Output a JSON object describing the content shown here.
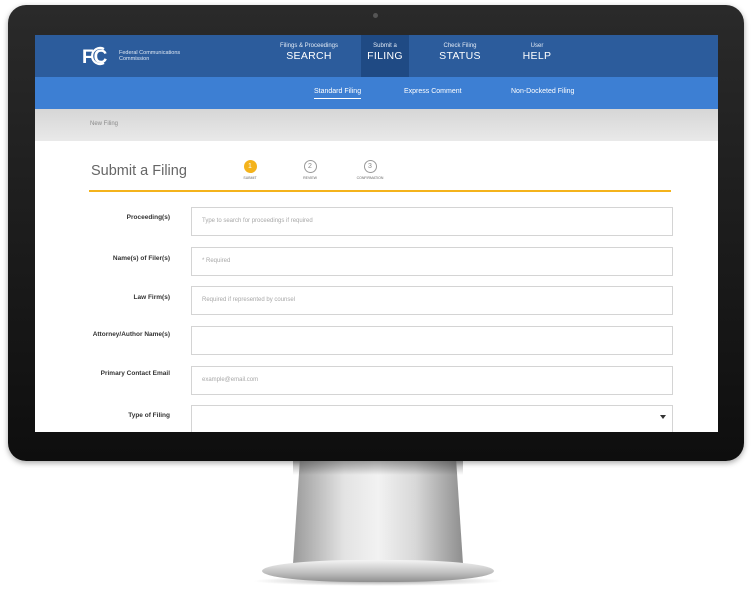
{
  "header": {
    "logo_text": "Federal Communications Commission",
    "logo_alt": "FCC",
    "nav": [
      {
        "small": "Filings & Proceedings",
        "big": "SEARCH",
        "active": false
      },
      {
        "small": "Submit a",
        "big": "FILING",
        "active": true
      },
      {
        "small": "Check Filing",
        "big": "STATUS",
        "active": false
      },
      {
        "small": "User",
        "big": "HELP",
        "active": false
      }
    ]
  },
  "subnav": {
    "items": [
      {
        "label": "Standard Filing",
        "active": true
      },
      {
        "label": "Express Comment",
        "active": false
      },
      {
        "label": "Non-Docketed Filing",
        "active": false
      }
    ]
  },
  "breadcrumb": "New Filing",
  "page": {
    "title": "Submit a Filing",
    "steps": [
      {
        "number": "1",
        "label": "SUBMIT",
        "active": true
      },
      {
        "number": "2",
        "label": "REVIEW",
        "active": false
      },
      {
        "number": "3",
        "label": "CONFIRMATION",
        "active": false
      }
    ]
  },
  "form": {
    "fields": [
      {
        "label": "Proceeding(s)",
        "placeholder": "Type to search for proceedings if required"
      },
      {
        "label": "Name(s) of Filer(s)",
        "placeholder": "* Required"
      },
      {
        "label": "Law Firm(s)",
        "placeholder": "Required if represented by counsel"
      },
      {
        "label": "Attorney/Author Name(s)",
        "placeholder": ""
      },
      {
        "label": "Primary Contact Email",
        "placeholder": "example@email.com"
      },
      {
        "label": "Type of Filing",
        "placeholder": ""
      }
    ]
  },
  "colors": {
    "top_nav": "#2c5c9c",
    "sub_nav": "#3d7fd3",
    "accent": "#f4b31c"
  },
  "icons": {
    "logo": "fcc-logo",
    "select": "caret-down-icon"
  }
}
